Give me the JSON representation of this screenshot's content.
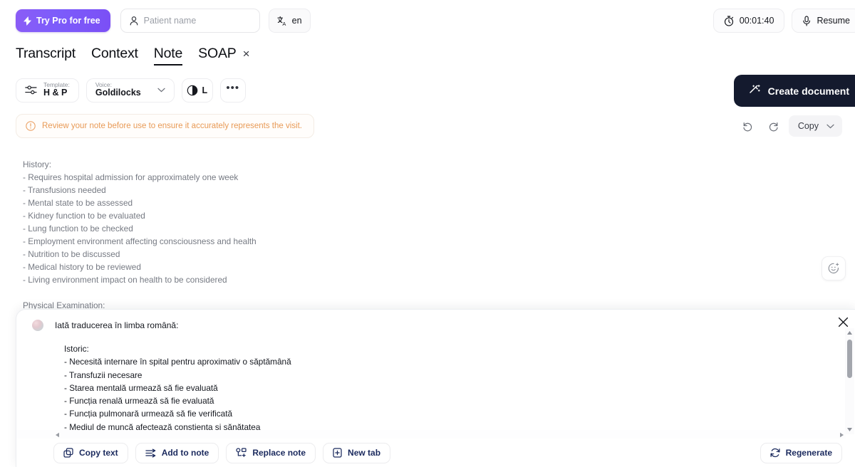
{
  "topbar": {
    "try_pro_label": "Try Pro for free",
    "patient_placeholder": "Patient name",
    "patient_value": "",
    "language_code": "en",
    "timer": "00:01:40",
    "resume_label": "Resume"
  },
  "tabs": [
    {
      "label": "Transcript",
      "active": false,
      "closable": false
    },
    {
      "label": "Context",
      "active": false,
      "closable": false
    },
    {
      "label": "Note",
      "active": true,
      "closable": false
    },
    {
      "label": "SOAP",
      "active": false,
      "closable": true
    }
  ],
  "toolbar": {
    "template_label": "Template:",
    "template_value": "H & P",
    "voice_label": "Voice:",
    "voice_value": "Goldilocks",
    "theme_value": "L",
    "more_label": "•••",
    "create_document_label": "Create document"
  },
  "note": {
    "warning": "Review your note before use to ensure it accurately represents the visit.",
    "copy_label": "Copy",
    "lines": [
      "History:",
      "- Requires hospital admission for approximately one week",
      "- Transfusions needed",
      "- Mental state to be assessed",
      "- Kidney function to be evaluated",
      "- Lung function to be checked",
      "- Employment environment affecting consciousness and health",
      "- Nutrition to be discussed",
      "- Medical history to be reviewed",
      "- Living environment impact on health to be considered"
    ],
    "section_two": "Physical Examination:"
  },
  "translation": {
    "title": "Iată traducerea în limba română:",
    "lines": [
      "Istoric:",
      "- Necesită internare în spital pentru aproximativ o săptămână",
      "- Transfuzii necesare",
      "- Starea mentală urmează să fie evaluată",
      "- Funcția renală urmează să fie evaluată",
      "- Funcția pulmonară urmează să fie verificată",
      "- Mediul de muncă afectează conștiența și sănătatea"
    ],
    "actions": [
      "Copy text",
      "Add to note",
      "Replace note",
      "New tab"
    ],
    "regenerate_label": "Regenerate"
  },
  "colors": {
    "brand_purple": "#7c5cfb",
    "dark_navy": "#141a2e",
    "warning_orange": "#e89a56",
    "action_blue": "#1b2a5e"
  }
}
